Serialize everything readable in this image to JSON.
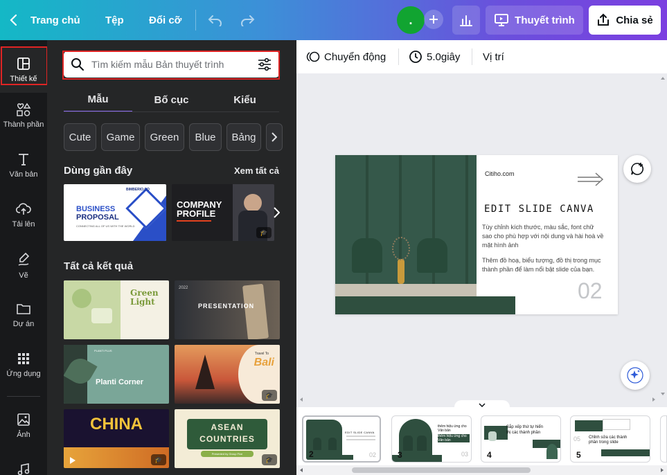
{
  "topbar": {
    "home_label": "Trang chủ",
    "file_label": "Tệp",
    "resize_label": "Đổi cỡ",
    "avatar_initial": ".",
    "present_label": "Thuyết trình",
    "share_label": "Chia sẻ"
  },
  "leftnav": {
    "items": [
      {
        "label": "Thiết kế",
        "icon": "layout-icon"
      },
      {
        "label": "Thành phần",
        "icon": "shapes-icon"
      },
      {
        "label": "Văn bản",
        "icon": "text-icon"
      },
      {
        "label": "Tải lên",
        "icon": "cloud-upload-icon"
      },
      {
        "label": "Vẽ",
        "icon": "draw-icon"
      },
      {
        "label": "Dự án",
        "icon": "folder-icon"
      },
      {
        "label": "Ứng dụng",
        "icon": "apps-grid-icon"
      },
      {
        "label": "Ảnh",
        "icon": "image-icon"
      }
    ]
  },
  "panel": {
    "search_placeholder": "Tìm kiếm mẫu Bản thuyết trình",
    "tabs": [
      "Mẫu",
      "Bố cục",
      "Kiểu"
    ],
    "chips": [
      "Cute",
      "Game",
      "Green",
      "Blue",
      "Bảng"
    ],
    "recent_title": "Dùng gần đây",
    "see_all": "Xem tất cả",
    "all_results_title": "Tất cả kết quả",
    "recent": [
      {
        "line1": "BUSINESS",
        "line2": "PROPOSAL",
        "small": "CONNECTING ALL OF US WITH THE WORLD",
        "brand": "BIMBERIO.CO"
      },
      {
        "line1": "COMPANY",
        "line2": "PROFILE"
      }
    ],
    "results": [
      {
        "title": "Green Light"
      },
      {
        "title": "PRESENTATION",
        "year": "2022"
      },
      {
        "title": "Planti Corner",
        "brand": "PLANTI PLUS"
      },
      {
        "title": "Bali",
        "pre": "Travel To"
      },
      {
        "title": "CHINA"
      },
      {
        "title": "ASEAN COUNTRIES",
        "sub": "Presented by Group Five"
      }
    ]
  },
  "toolbar2": {
    "animation_label": "Chuyển động",
    "duration_label": "5.0giây",
    "position_label": "Vị trí"
  },
  "slide": {
    "site": "Citiho.com",
    "title": "EDIT SLIDE CANVA",
    "para1": "Tùy chỉnh kích thước, màu sắc, font chữ sao cho phù hợp với nội dung và hài hoà về mặt hình ảnh",
    "para2": "Thêm đồ hoạ, biểu tượng, đồ thị trong mục thành phần để làm nổi bật slide của bạn.",
    "number": "02"
  },
  "pages": [
    {
      "num": "2",
      "mini_title": "EDIT SLIDE CANVA",
      "corner": "02"
    },
    {
      "num": "3",
      "text": "thêm hiệu ứng cho Văn bản",
      "text2": "thêm hiệu ứng cho Văn bản",
      "corner": "03"
    },
    {
      "num": "4",
      "text": "Sắp xếp thứ tự hiển thị các thành phần"
    },
    {
      "num": "5",
      "text": "Chỉnh sửa các thành phần trong slide",
      "corner": "05"
    }
  ],
  "colors": {
    "accent": "#8b3dff",
    "highlight": "#e02424",
    "slide_green": "#2f4f3f"
  }
}
